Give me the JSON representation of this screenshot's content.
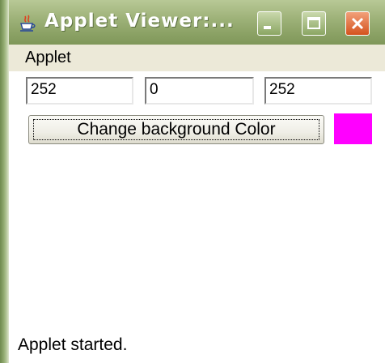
{
  "window": {
    "title": "Applet Viewer:...",
    "icon": "java-cup-icon"
  },
  "title_buttons": {
    "minimize_icon": "minimize-icon",
    "maximize_icon": "maximize-icon",
    "close_icon": "close-icon"
  },
  "menubar": {
    "items": [
      {
        "label": "Applet"
      }
    ]
  },
  "fields": {
    "red": "252",
    "green": "0",
    "blue": "252"
  },
  "change_button": {
    "label": "Change background Color"
  },
  "swatch": {
    "color": "#ff00ff"
  },
  "status": {
    "text": "Applet started."
  },
  "colors": {
    "titlebar": "#8ea468",
    "menubar": "#ece9d8",
    "close_button": "#d4531e"
  }
}
